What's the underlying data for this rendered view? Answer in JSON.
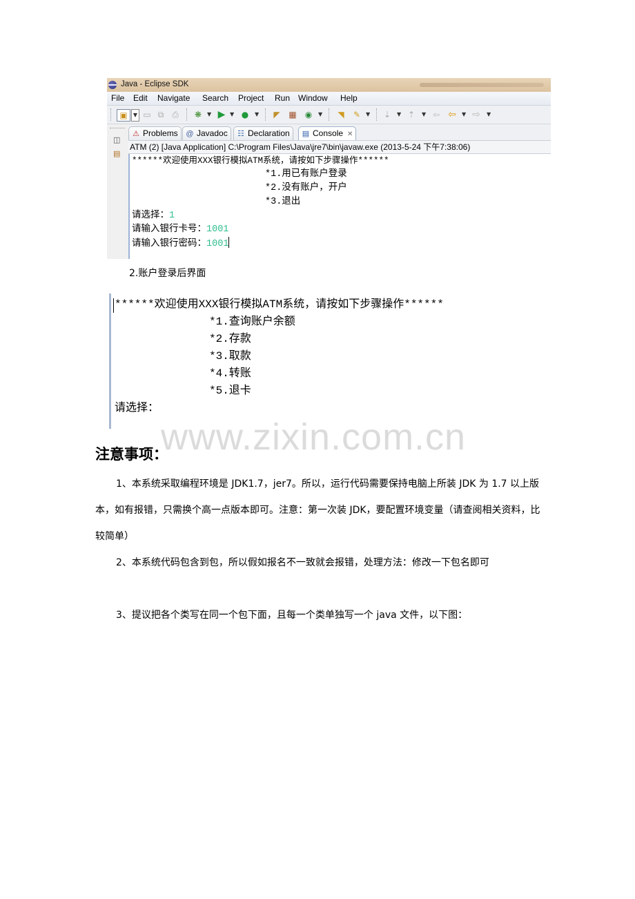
{
  "eclipse": {
    "window_title": "Java - Eclipse SDK",
    "menu": [
      "File",
      "Edit",
      "Navigate",
      "Search",
      "Project",
      "Run",
      "Window",
      "Help"
    ],
    "toolbar_icons": [
      "new-wizard-icon",
      "save-icon",
      "save-all-icon",
      "print-icon",
      "debug-icon",
      "run-icon",
      "external-tools-icon",
      "new-java-project-icon",
      "new-package-icon",
      "new-class-icon",
      "open-type-icon",
      "search-icon",
      "next-annotation-icon",
      "previous-annotation-icon",
      "last-edit-location-icon",
      "back-icon",
      "forward-icon"
    ],
    "tabs": [
      {
        "label": "Problems",
        "icon": "problems-icon"
      },
      {
        "label": "Javadoc",
        "icon": "javadoc-icon",
        "glyph": "@"
      },
      {
        "label": "Declaration",
        "icon": "declaration-icon"
      },
      {
        "label": "Console",
        "icon": "console-icon",
        "active": true
      }
    ],
    "console_header": "ATM (2) [Java Application] C:\\Program Files\\Java\\jre7\\bin\\javaw.exe (2013-5-24 下午7:38:06)",
    "console_lines": {
      "banner": "******欢迎使用XXX银行模拟ATM系统，请按如下步骤操作******",
      "menu": [
        "*1.用已有账户登录",
        "*2.没有账户，开户",
        "*3.退出"
      ],
      "prompts": [
        {
          "label": "请选择：",
          "input": "1"
        },
        {
          "label": "请输入银行卡号：",
          "input": "1001"
        },
        {
          "label": "请输入银行密码：",
          "input": "1001"
        }
      ]
    }
  },
  "caption": "2.账户登录后界面",
  "console2": {
    "banner": "******欢迎使用XXX银行模拟ATM系统，请按如下步骤操作******",
    "menu": [
      "*1.查询账户余额",
      "*2.存款",
      "*3.取款",
      "*4.转账",
      "*5.退卡"
    ],
    "prompt": "请选择："
  },
  "watermark": "www.zixin.com.cn",
  "notes": {
    "heading": "注意事项：",
    "paragraphs": [
      "1、本系统采取编程环境是 JDK1.7，jer7。所以，运行代码需要保持电脑上所装 JDK 为 1.7 以上版本，如有报错，只需换个高一点版本即可。注意：第一次装 JDK，要配置环境变量（请查阅相关资料，比较简单）",
      "2、本系统代码包含到包，所以假如报名不一致就会报错，处理方法：修改一下包名即可",
      "3、提议把各个类写在同一个包下面，且每一个类单独写一个 java 文件，以下图："
    ]
  },
  "colors": {
    "user_input": "#2fbf8c",
    "console_border": "#9cb3d6"
  }
}
